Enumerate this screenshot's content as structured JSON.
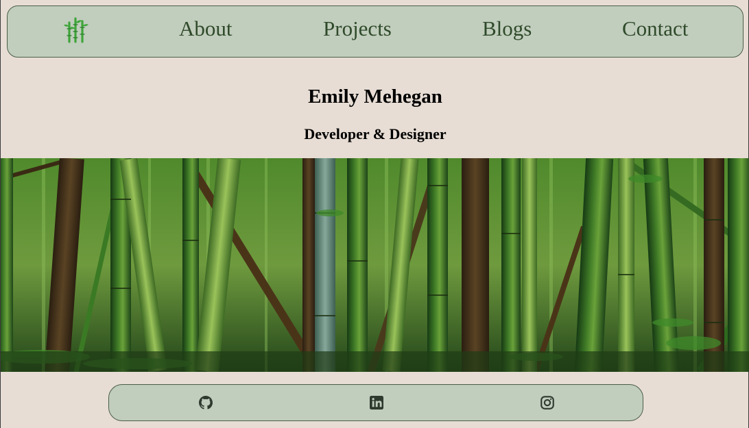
{
  "nav": {
    "logo_icon": "bamboo-icon",
    "links": [
      {
        "label": "About"
      },
      {
        "label": "Projects"
      },
      {
        "label": "Blogs"
      },
      {
        "label": "Contact"
      }
    ]
  },
  "header": {
    "name": "Emily Mehegan",
    "role": "Developer & Designer"
  },
  "hero": {
    "image": "bamboo-forest"
  },
  "footer": {
    "icons": [
      "github-icon",
      "linkedin-icon",
      "instagram-icon"
    ]
  },
  "colors": {
    "page_background": "#e7ddd4",
    "panel_background": "#c1cdbd",
    "panel_border": "#4a5d46",
    "nav_text": "#2f4a2a",
    "logo_green": "#3fa53a"
  }
}
